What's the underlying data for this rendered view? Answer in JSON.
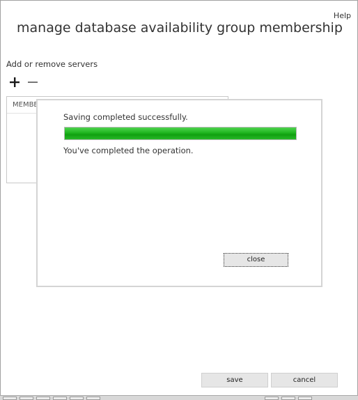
{
  "header": {
    "help_label": "Help",
    "title": "manage database availability group membership"
  },
  "servers": {
    "section_label": "Add or remove servers",
    "add_icon": "plus-icon",
    "remove_icon": "minus-icon",
    "list": {
      "column_header": "MEMBE"
    }
  },
  "dialog": {
    "status_text": "Saving completed successfully.",
    "progress_percent": 100,
    "progress_color": "#1fb51f",
    "message": "You've completed the operation.",
    "close_label": "close"
  },
  "footer": {
    "save_label": "save",
    "cancel_label": "cancel"
  }
}
